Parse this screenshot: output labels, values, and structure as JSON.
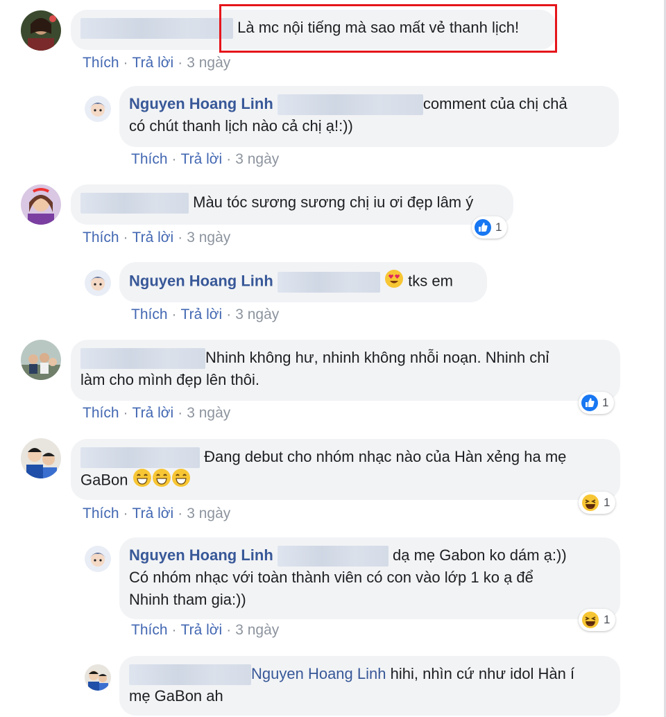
{
  "actions": {
    "like": "Thích",
    "reply": "Trả lời",
    "separator": "·",
    "time": "3 ngày"
  },
  "comments": [
    {
      "text": "Là mc nội tiếng mà sao mất vẻ thanh lịch!"
    },
    {
      "author": "Nguyen Hoang Linh",
      "text_line1": "comment của chị chả",
      "text_line2": "có chút thanh lịch nào cả chị ạ!:))"
    },
    {
      "text": "Màu tóc sương sương chị iu ơi đẹp lâm ý",
      "reaction_count": "1",
      "reaction": "like-icon"
    },
    {
      "author": "Nguyen Hoang Linh",
      "text": "tks em",
      "emoji": "heart-eyes-emoji"
    },
    {
      "text_line1": "Nhinh không hư, nhinh không nhỗi noạn. Nhinh chỉ",
      "text_line2": "làm cho mình đẹp lên thôi.",
      "reaction_count": "1",
      "reaction": "like-icon"
    },
    {
      "text_line1": "Đang debut cho nhóm nhạc nào của Hàn xẻng ha mẹ",
      "text_line2": "GaBon",
      "emoji": "grinning-emoji",
      "reaction_count": "1",
      "reaction": "haha-icon"
    },
    {
      "author": "Nguyen Hoang Linh",
      "text_line1": "dạ mẹ Gabon ko dám ạ:))",
      "text_line2": "Có nhóm nhạc với toàn thành viên có con vào lớp 1 ko ạ để",
      "text_line3": "Nhinh tham gia:))",
      "reaction_count": "1",
      "reaction": "haha-icon"
    },
    {
      "mention": "Nguyen Hoang Linh",
      "text_line1": "hihi, nhìn cứ như idol Hàn í",
      "text_line2": "mẹ GaBon ah"
    }
  ],
  "colors": {
    "link": "#4267b2",
    "name": "#385898",
    "bubble": "#f2f3f5",
    "highlight": "#e5151b",
    "like_blue": "#1877f2",
    "emoji_yellow": "#f7c634"
  }
}
